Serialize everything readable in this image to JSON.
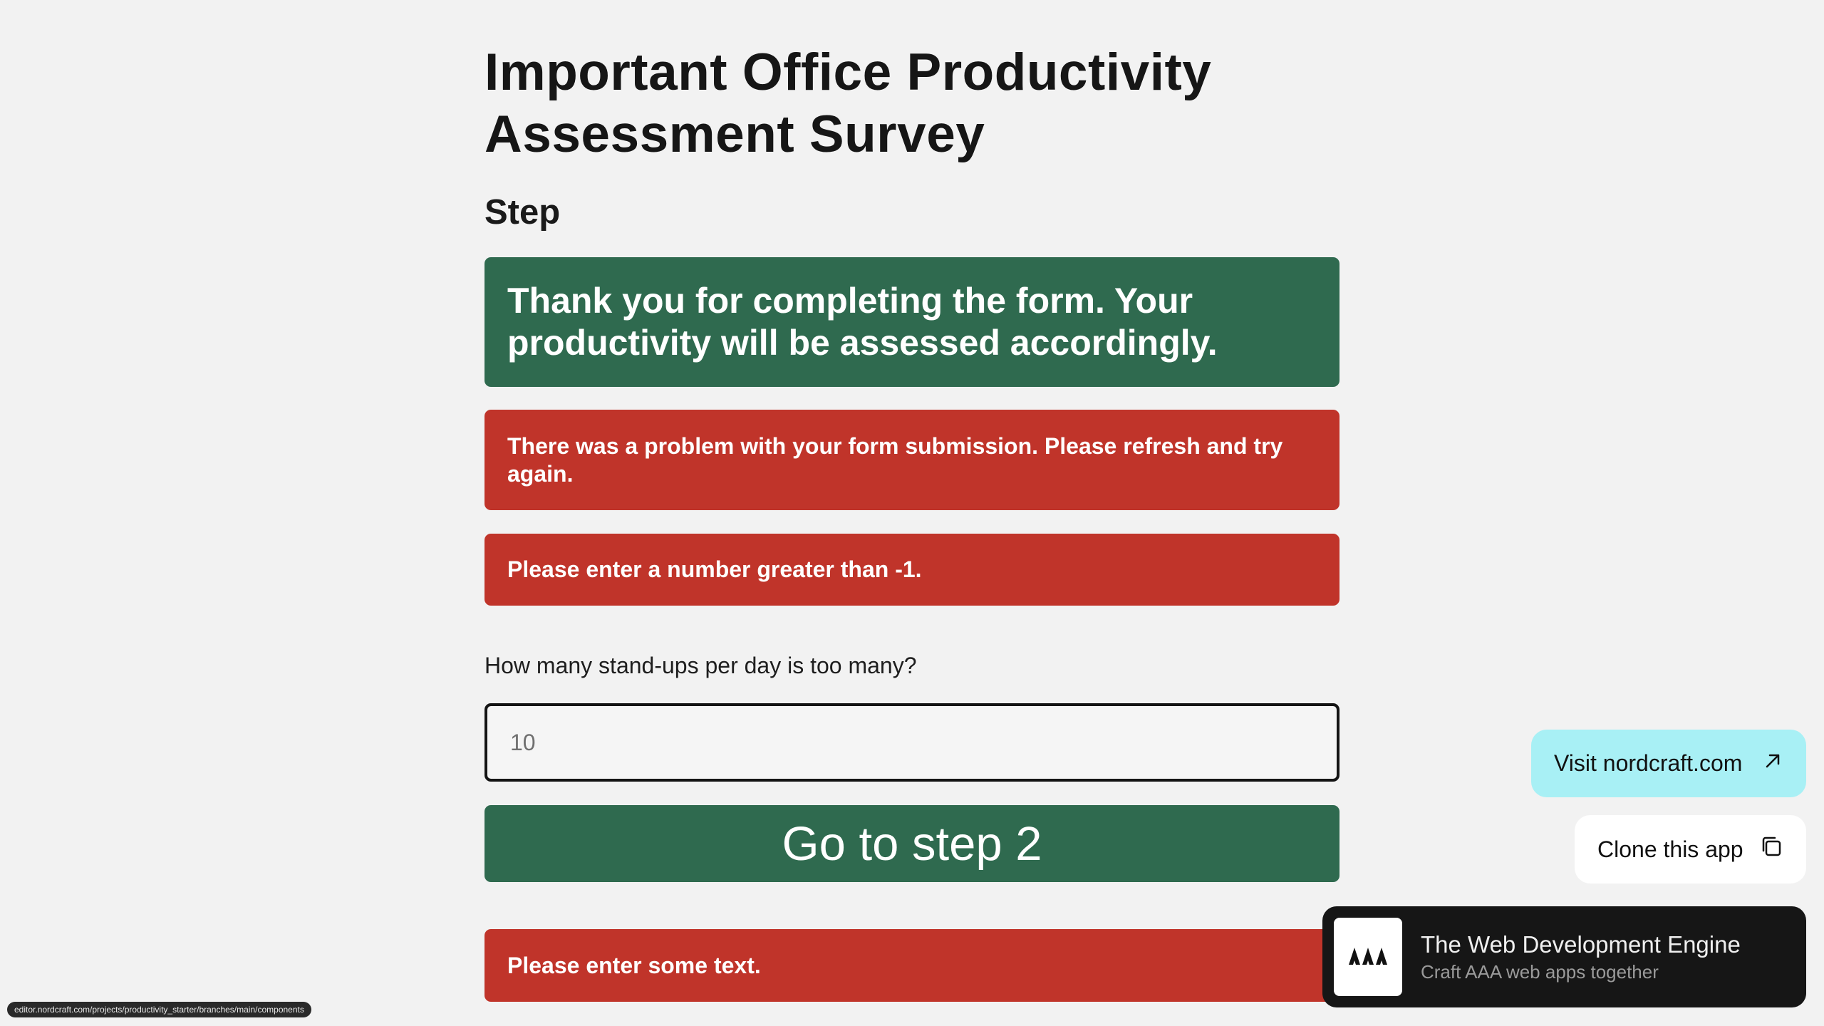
{
  "survey": {
    "title_line1": "Important Office Productivity",
    "title_line2": "Assessment Survey",
    "step_heading": "Step",
    "success_message": "Thank you for completing the form. Your productivity will be assessed accordingly.",
    "submission_error": "There was a problem with your form submission. Please refresh and try again.",
    "number_error": "Please enter a number greater than -1.",
    "question_label": "How many stand-ups per day is too many?",
    "input_placeholder": "10",
    "next_button": "Go to step 2",
    "text_error": "Please enter some text."
  },
  "floating": {
    "visit_label": "Visit nordcraft.com",
    "visit_icon": "arrow-up-right-icon",
    "clone_label": "Clone this app",
    "clone_icon": "copy-icon",
    "promo_title": "The Web Development Engine",
    "promo_subtitle": "Craft AAA web apps together",
    "promo_logo_icon": "nordcraft-trees-logo"
  },
  "status_bar": {
    "url": "editor.nordcraft.com/projects/productivity_starter/branches/main/components"
  },
  "colors": {
    "success": "#2f6a4f",
    "error": "#c0342a",
    "visit_bg": "#a8f0f5",
    "background": "#f2f2f2"
  }
}
